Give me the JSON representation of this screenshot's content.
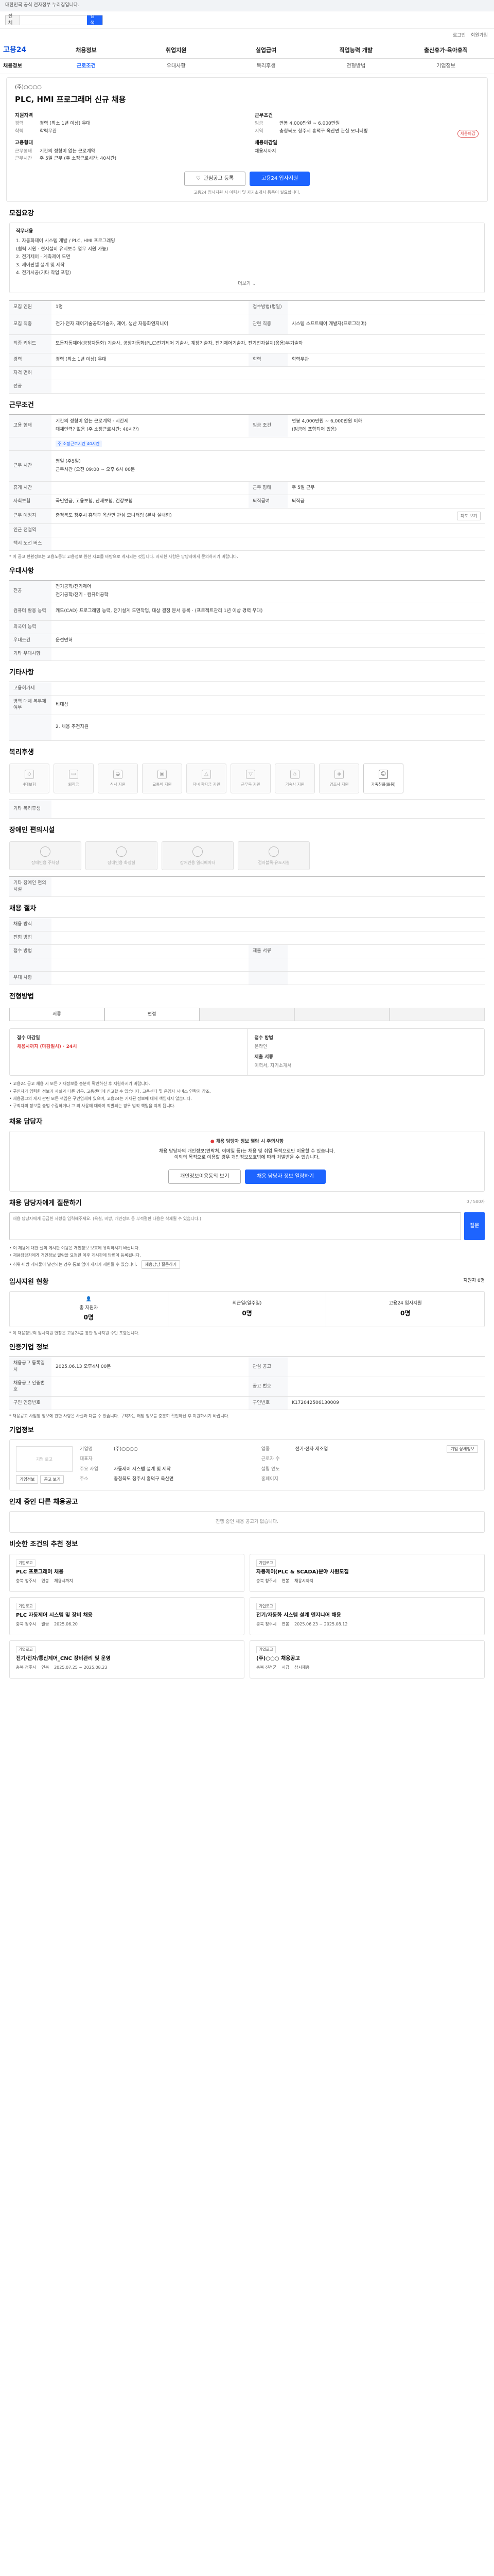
{
  "topbar": {
    "text": "대한민국 공식 전자정부 누리집입니다."
  },
  "search": {
    "scope": "전체",
    "placeholder": "",
    "button": "검색"
  },
  "util": {
    "login": "로그인",
    "signup": "회원가입"
  },
  "gnb": {
    "logo": "고용24",
    "items": [
      "채용정보",
      "취업지원",
      "실업급여",
      "직업능력 개발",
      "출산휴가·육아휴직"
    ]
  },
  "lnb": {
    "items": [
      "채용정보",
      "근로조건",
      "우대사항",
      "복리후생",
      "전형방법",
      "기업정보"
    ]
  },
  "job": {
    "company": "(주)○○○○",
    "title": "PLC, HMI 프로그래머 신규 채용",
    "status_badge": "채용마감",
    "sum_left_h": "지원자격",
    "career_k": "경력",
    "career_v": "경력 (최소 1년 이상) 우대",
    "edu_k": "학력",
    "edu_v": "학력무관",
    "sum_right_h": "근무조건",
    "pay_k": "임금",
    "pay_v": "연봉 4,000만원 ~ 6,000만원",
    "area_k": "지역",
    "area_v": "충청북도 청주시 흥덕구 옥산면 관심 모니터링",
    "emp_h": "고용형태",
    "emp_k": "근무형태",
    "emp_v": "기간의 정함이 없는 근로계약",
    "shift_k": "근무시간",
    "shift_v": "주 5일 근무 (주 소정근로시간: 40시간)",
    "due_h": "채용마감일",
    "due_v": "채용시까지",
    "btn_scrap": "관심공고 등록",
    "btn_apply": "고용24 입사지원",
    "notice": "고용24 입사지원 시 이력서 및 자기소개서 등록이 필요합니다."
  },
  "recruit": {
    "heading": "모집요강",
    "box_title": "직무내용",
    "lines": [
      "1. 자동화제어 시스템 개발 / PLC, HMI 프로그래밍",
      "   (협력 지원 · 현지설비 유지보수 업무 지원 가능)",
      "2. 전기제어 · 계측제어 도면",
      "3. 제어판넬 설계 및 제작",
      "4. 전기시공(기타 작업 포함)"
    ],
    "more": "더보기"
  },
  "recruit_tbl": {
    "r1k": "모집 인원",
    "r1v": "1명",
    "r1k2": "접수방법(평일)",
    "r1v2": "",
    "r2k": "모집 직종",
    "r2v": "전기·전자 제어기술공학기술자, 제어, 생산 자동화엔지니어",
    "r2k2": "관련 직종",
    "r2v2": "시스템 소프트웨어 개발자(프로그래머)",
    "r3k": "직종 키워드",
    "r3v": "모든자동제어(공장자동화) 기술사, 공장자동화(PLC)전기제어 기술사, 계장기술자, 전기제어기술자, 전기전자설계(응용)부기술자",
    "r4k": "경력",
    "r4v": "경력 (최소 1년 이상) 우대",
    "r4k2": "학력",
    "r4v2": "학력무관",
    "r5k": "자격 면허",
    "r5v": "",
    "r6k": "전공",
    "r6v": ""
  },
  "cond": {
    "heading": "근무조건",
    "c1k": "고용 형태",
    "c1v1": "기간의 정함이 없는 근로계약 · 시간제",
    "c1v2": "대체인력? 없음 (주 소정근로시간: 40시간)",
    "c1k2": "임금 조건",
    "c1v3": "연봉 4,000만원 ~ 6,000만원 이하",
    "c1v4": "(임금에 포함되어 있음)",
    "c2k": "",
    "c2tag": "주 소정근로시간 40시간",
    "c3k": "근무 시간",
    "c3v1": "평일 (주5일)",
    "c3v2": "근무시간 (오전 09:00 ~ 오후 6시 00분",
    "c4k": "휴게 시간",
    "c4v": "",
    "c4k2": "근무 형태",
    "c4v2": "주 5일 근무",
    "c5k": "사회보험",
    "c5v": "국민연금, 고용보험, 산재보험, 건강보험",
    "c5k2": "퇴직급여",
    "c5v2": "퇴직금",
    "c6k": "근무 예정지",
    "c6v": "충청북도 청주시 흥덕구 옥산면 관심 모니터링 (본사 실내형)",
    "c6btn": "지도 보기",
    "c7k": "인근 전철역",
    "c7v": "",
    "c8k": "택시 노선 버스",
    "c8v": "",
    "foot": "* 이 공고 현황정보는 고용노동부 고용정보 원천 자료를 바탕으로 게시되는 것입니다. 자세한 사항은 담당자에게 문의하시기 바랍니다."
  },
  "pref": {
    "heading": "우대사항",
    "p1k": "전공",
    "p1v1": "전기공학/전기제어",
    "p1v2": "전기공학/전기 · 컴퓨터공학",
    "p2k": "컴퓨터 활용 능력",
    "p2v": "캐드(CAD) 프로그래밍 능력, 전기설계 도면작업, 대상 결정 문서 등록 · (프로젝트관리 1년 이상 경력 우대)",
    "p3k": "외국어 능력",
    "p3v": "",
    "p4k": "우대조건",
    "p4v": "운전면허",
    "p5k": "기타 우대사항",
    "p5v": ""
  },
  "other": {
    "heading": "기타사항",
    "o1k": "고용허가제",
    "o1v": "",
    "o2k": "병역 대체 복무제 여부",
    "o2v": "비대상",
    "o3k": "",
    "o3v1": "2. 채용 추천지원",
    "o3v2": ""
  },
  "welfare": {
    "heading": "복리후생",
    "items": [
      "4대보험",
      "퇴직금",
      "식사 지원",
      "교통비 지원",
      "자녀 학자금 지원",
      "근무복 지원",
      "기숙사 지원",
      "경조사 지원",
      "가족친화(돌봄)"
    ],
    "note_k": "기타 복리후생",
    "note_v": ""
  },
  "facility": {
    "heading": "장애인 편의시설",
    "items": [
      "장애인용 주차장",
      "장애인용 화장실",
      "장애인용 엘리베이터",
      "점자블록·유도시설"
    ],
    "note_k": "기타 장애인 편의시설",
    "note_v": ""
  },
  "hire": {
    "heading": "채용 절차",
    "h1k": "채용 방식",
    "h1v": "",
    "h2k": "전형 방법",
    "h2v": "",
    "h3k": "접수 방법",
    "h3v": "",
    "h3k2": "제출 서류",
    "h3v2": "",
    "h4k": "",
    "h4v": "",
    "h4k2": "",
    "h4v2": "",
    "h5k": "우대 사항",
    "h5v": "",
    "h5k2": "",
    "h5v2": ""
  },
  "process": {
    "heading": "전형방법",
    "steps": [
      "서류",
      "면접",
      "",
      "",
      ""
    ]
  },
  "apply": {
    "deadline_h": "접수 마감일",
    "deadline_v": "채용시까지 (마감일시) · 24시",
    "method_h": "접수 방법",
    "method_v": "온라인",
    "doc_h": "제출 서류",
    "doc_v": "이력서, 자기소개서",
    "bullets": [
      "• 고용24 공고 채용 시 모든 기재정보를 충분히 확인하신 후 지원하시기 바랍니다.",
      "• 구인자가 입력한 정보가 사실과 다른 경우, 고용센터에 신고할 수 있습니다. 고용센터 및 운영자 서비스 연락처 참조.",
      "• 채용공고의 게시 관련 모든 책임은 구인업체에 있으며, 고용24는 기재된 정보에 대해 책임지지 않습니다.",
      "• 구직자의 정보를 불법 수집하거나 그 외 사용에 대하여 적발되는 경우 법적 책임을 지게 됩니다."
    ]
  },
  "contact": {
    "heading": "채용 담당자",
    "alert": "채용 담당자 정보 열람 시 주의사항",
    "msg1": "채용 담당자의 개인정보(연락처, 이메일 등)는 채용 및 취업 목적으로만 이용할 수 있습니다.",
    "msg2": "이외의 목적으로 이용할 경우 개인정보보호법에 따라 처벌받을 수 있습니다.",
    "btn1": "개인정보이용동의 보기",
    "btn2": "채용 담당자 정보 열람하기"
  },
  "qna": {
    "heading": "채용 담당자에게 질문하기",
    "count": "0 / 500자",
    "placeholder": "채용 담당자에게 궁금한 사항을 입력해주세요. (욕설, 비방, 개인정보 등 부적절한 내용은 삭제될 수 있습니다.)",
    "send": "질문",
    "notes": [
      "• 이 채용에 대한 질의 게시판 이용은 개인정보 보호에 유의하시기 바랍니다.",
      "• 채용담당자에게 개인정보 열람을 요청한 이후 게시판에 답변이 등록됩니다.",
      "• 허위·비방 게시물이 발견되는 경우 통보 없이 게시가 제한될 수 있습니다."
    ],
    "more_btn": "채용담당 질문하기"
  },
  "stats": {
    "heading": "입사지원 현황",
    "total_k": "지원자",
    "total_v": "0명",
    "c1": "총 지원자",
    "c1v": "0명",
    "c2": "최근일(일주일)",
    "c2v": "0명",
    "c3": "고용24 입사지원",
    "c3v": "0명",
    "note": "* 이 채용정보의 입사지원 현황은 고용24를 통한 입사지원 수만 포함됩니다."
  },
  "manage": {
    "heading": "인증기업 정보",
    "m1k": "채용공고 등록일시",
    "m1v": "2025.06.13 오후4시 00분",
    "m1k2": "관심 공고",
    "m1v2": "",
    "m2k": "채용공고 인증번호",
    "m2v": "",
    "m2k2": "공고 번호",
    "m2v2": "",
    "m3k": "구인 인증번호",
    "m3v": "",
    "m3k2": "구인번호",
    "m3v2": "K172042506130009",
    "foot": "* 채용공고 사업장 정보에 관한 사항은 사실과 다를 수 있습니다. 구직자는 해당 정보를 충분히 확인하신 후 지원하시기 바랍니다."
  },
  "corp": {
    "heading": "기업정보",
    "logo": "기업 로고",
    "rows": [
      [
        "기업명",
        "(주)○○○○",
        "업종",
        "전기·전자 제조업"
      ],
      [
        "대표자",
        "",
        "근로자 수",
        ""
      ],
      [
        "주요 사업",
        "자동제어 시스템 설계 및 제작",
        "설립 연도",
        ""
      ],
      [
        "주소",
        "충청북도 청주시 흥덕구 옥산면",
        "홈페이지",
        ""
      ]
    ],
    "btn1": "기업정보",
    "btn2": "공고 보기",
    "btn3": "기업 상세정보"
  },
  "others": {
    "heading": "인재 중인 다른 채용공고",
    "empty": "진행 중인 채용 공고가 없습니다."
  },
  "similar": {
    "heading": "비슷한 조건의 추천 정보",
    "cards": [
      {
        "logo": "기업로고",
        "title": "PLC 프로그래머 채용",
        "loc": "충북 청주시",
        "pay": "연봉",
        "period": "채용시까지"
      },
      {
        "logo": "기업로고",
        "title": "자동제어(PLC & SCADA)분야 사원모집",
        "loc": "충북 청주시",
        "pay": "연봉",
        "period": "채용시까지"
      },
      {
        "logo": "기업로고",
        "title": "PLC 자동제어 시스템 및 장비 채용",
        "loc": "충북 청주시",
        "pay": "월급",
        "period": "2025.06.20"
      },
      {
        "logo": "기업로고",
        "title": "전기/자동화 시스템 설계 엔지니어 채용",
        "loc": "충북 청주시",
        "pay": "연봉",
        "period": "2025.06.23 ~ 2025.08.12"
      },
      {
        "logo": "기업로고",
        "title": "전기/전자/통신제어_CNC 장비관리 및 운영",
        "loc": "충북 청주시",
        "pay": "연봉",
        "period": "2025.07.25 ~ 2025.08.23"
      },
      {
        "logo": "기업로고",
        "title": "(주)○○○ 채용공고",
        "loc": "충북 진천군",
        "pay": "시급",
        "period": "상시채용"
      }
    ]
  }
}
